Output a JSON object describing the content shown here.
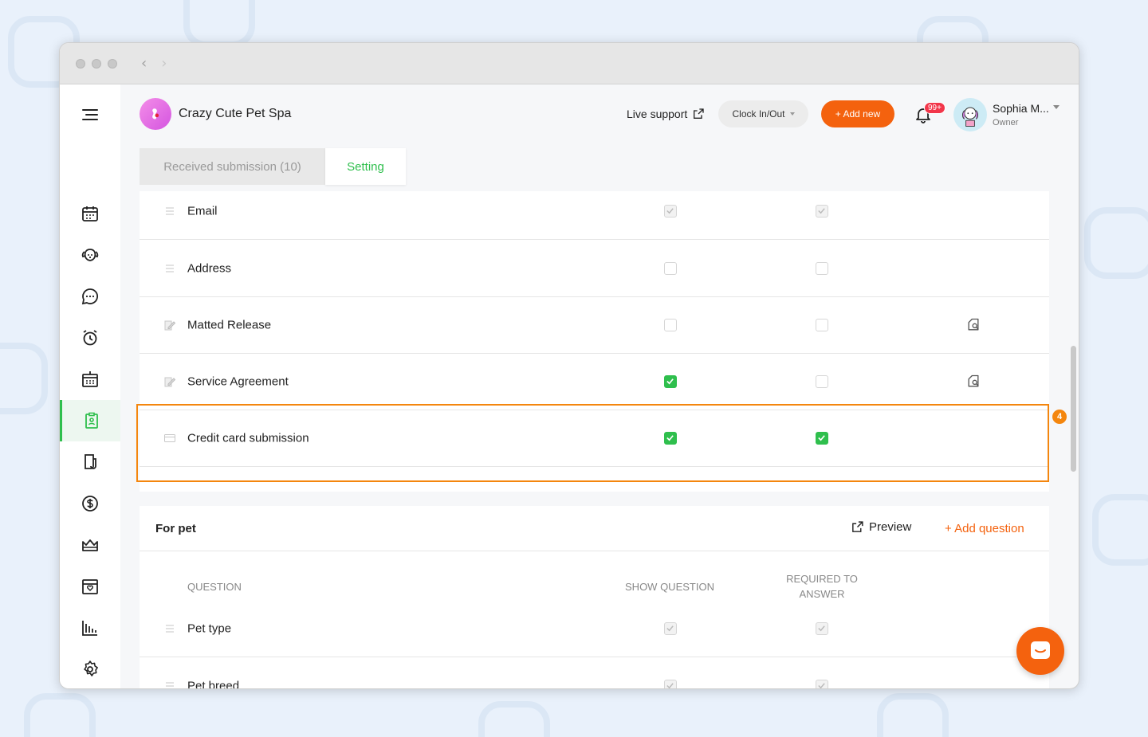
{
  "app": {
    "brand_name": "Crazy Cute Pet Spa",
    "live_support": "Live support",
    "clock_label": "Clock In/Out",
    "add_new": "+ Add new",
    "notification_count": "99+",
    "user_name": "Sophia M...",
    "user_role": "Owner"
  },
  "tabs": [
    {
      "label": "Received submission (10)",
      "active": false
    },
    {
      "label": "Setting",
      "active": true
    }
  ],
  "client_questions": [
    {
      "label": "Email",
      "icon": "drag-handle-icon",
      "show": true,
      "required": true,
      "locked": true,
      "preview": false
    },
    {
      "label": "Address",
      "icon": "drag-handle-icon",
      "show": false,
      "required": false,
      "locked": false,
      "preview": false
    },
    {
      "label": "Matted Release",
      "icon": "agreement-icon",
      "show": false,
      "required": false,
      "locked": false,
      "preview": true
    },
    {
      "label": "Service Agreement",
      "icon": "agreement-icon",
      "show": true,
      "required": false,
      "locked": false,
      "preview": true
    },
    {
      "label": "Credit card submission",
      "icon": "credit-card-icon",
      "show": true,
      "required": true,
      "locked": false,
      "preview": false
    }
  ],
  "step_marker": "4",
  "pet_section": {
    "title": "For pet",
    "preview": "Preview",
    "add_question": "+ Add question",
    "col_question": "QUESTION",
    "col_show": "SHOW QUESTION",
    "col_required": "REQUIRED TO ANSWER",
    "rows": [
      {
        "label": "Pet type",
        "show": true,
        "required": true,
        "locked": true
      },
      {
        "label": "Pet breed",
        "show": true,
        "required": true,
        "locked": true
      }
    ]
  },
  "colors": {
    "accent_green": "#2fbf4d",
    "accent_orange": "#f4620e",
    "highlight_orange": "#f4860e"
  },
  "sidebar_icons": [
    "menu-icon",
    "calendar-icon",
    "pet-face-icon",
    "chat-icon",
    "alarm-icon",
    "schedule-icon",
    "intake-form-icon",
    "agreement-doc-icon",
    "dollar-icon",
    "crown-icon",
    "booking-icon",
    "report-icon",
    "settings-icon"
  ]
}
